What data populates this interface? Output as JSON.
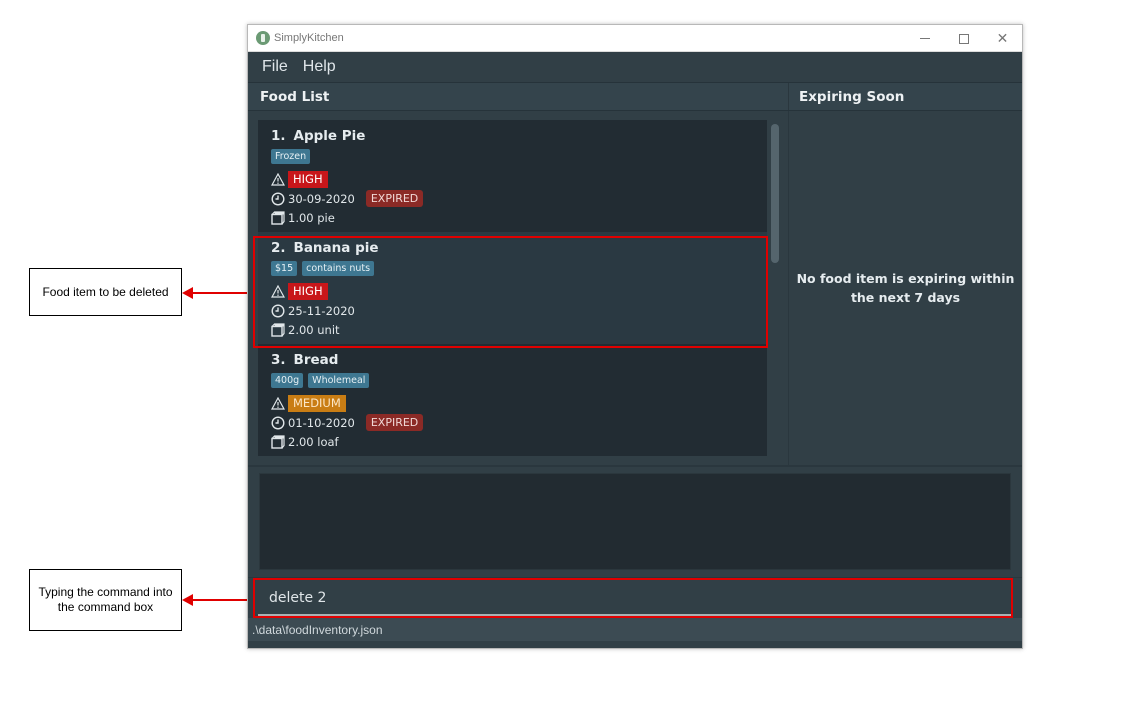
{
  "window": {
    "title": "SimplyKitchen",
    "controls": [
      "minimize",
      "maximize",
      "close"
    ]
  },
  "menu": {
    "items": [
      {
        "label": "File"
      },
      {
        "label": "Help"
      }
    ]
  },
  "panels": {
    "food_list_title": "Food List",
    "expiring_title": "Expiring Soon"
  },
  "food_items": [
    {
      "index": "1.",
      "name": "Apple Pie",
      "tags": [
        "Frozen"
      ],
      "priority": "HIGH",
      "expiry_date": "30-09-2020",
      "expired_label": "EXPIRED",
      "quantity": "1.00 pie"
    },
    {
      "index": "2.",
      "name": "Banana pie",
      "tags": [
        "$15",
        "contains nuts"
      ],
      "priority": "HIGH",
      "expiry_date": "25-11-2020",
      "expired_label": null,
      "quantity": "2.00 unit"
    },
    {
      "index": "3.",
      "name": "Bread",
      "tags": [
        "400g",
        "Wholemeal"
      ],
      "priority": "MEDIUM",
      "expiry_date": "01-10-2020",
      "expired_label": "EXPIRED",
      "quantity": "2.00 loaf"
    }
  ],
  "expiring_soon": {
    "message": "No food item is expiring within the next 7 days"
  },
  "result_display": {
    "text": ""
  },
  "command_box": {
    "value": "delete 2"
  },
  "status_bar": {
    "file_path": ".\\data\\foodInventory.json"
  },
  "annotations": [
    {
      "text": "Food item to be deleted",
      "target": "food-item-2"
    },
    {
      "text": "Typing the command into the command box",
      "target": "command-box"
    }
  ],
  "colors": {
    "priority_high": "#c8161a",
    "priority_medium": "#c97d14",
    "expired": "#8b2a26",
    "tag": "#3e7791",
    "annotation": "#e00000"
  }
}
